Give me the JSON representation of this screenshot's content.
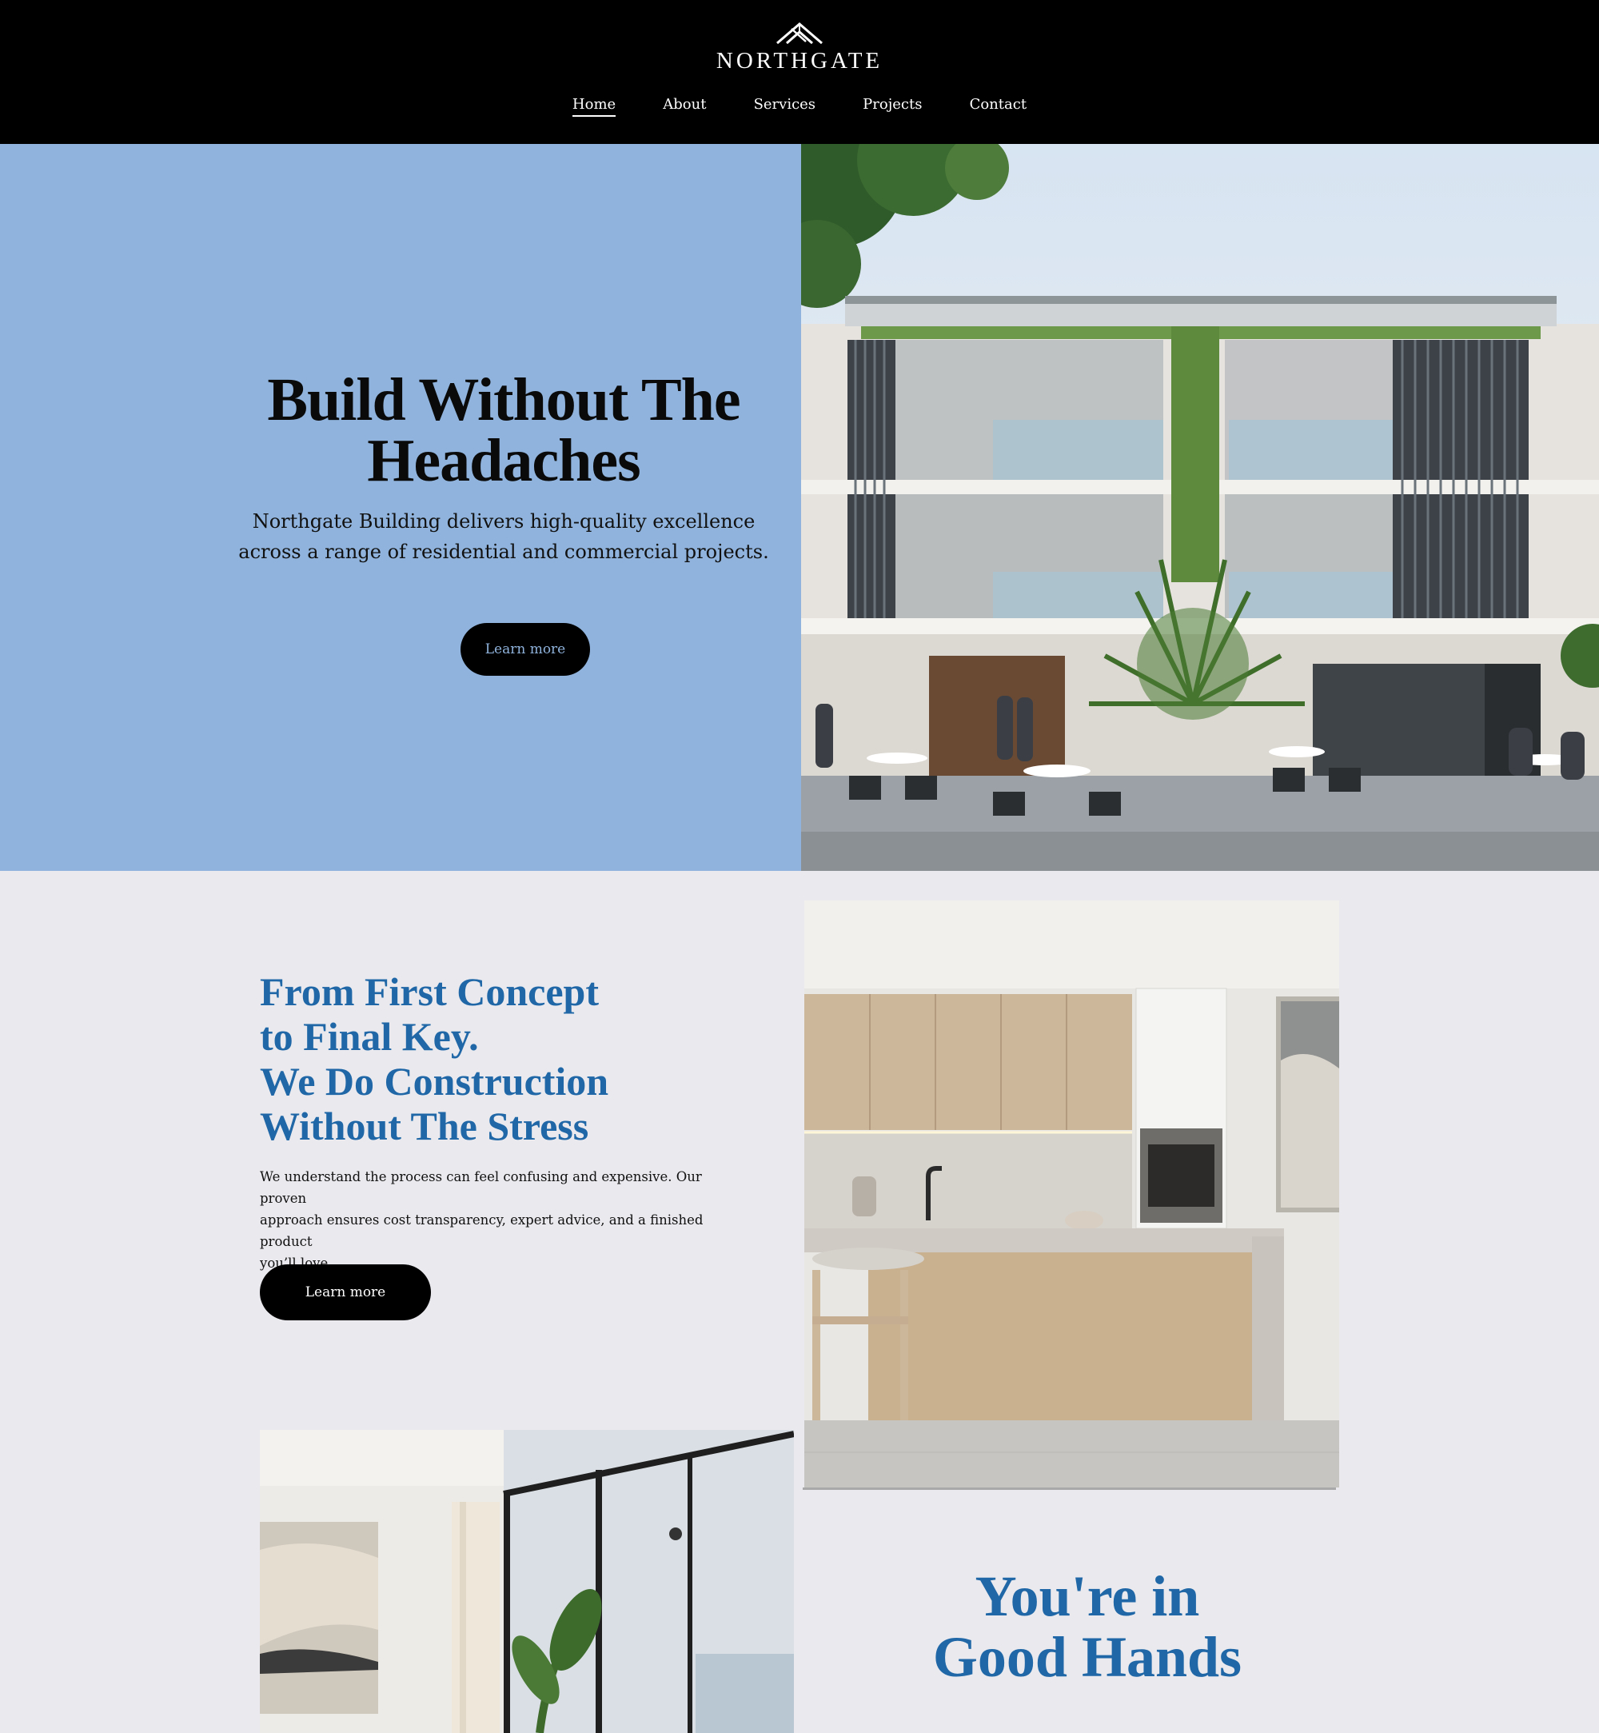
{
  "brand": {
    "name": "NORTHGATE",
    "logo_icon": "roof-chevron-icon"
  },
  "nav": {
    "items": [
      {
        "label": "Home",
        "active": true
      },
      {
        "label": "About",
        "active": false
      },
      {
        "label": "Services",
        "active": false
      },
      {
        "label": "Projects",
        "active": false
      },
      {
        "label": "Contact",
        "active": false
      }
    ]
  },
  "hero": {
    "title_line1": "Build Without The",
    "title_line2": "Headaches",
    "subtitle_line1": "Northgate Building delivers high-quality excellence",
    "subtitle_line2": "across a range of residential and commercial projects.",
    "button_label": "Learn more",
    "background_color": "#8fb3dc"
  },
  "section2": {
    "title_lines": [
      "From First Concept",
      "to Final Key.",
      "We Do Construction",
      "Without The Stress"
    ],
    "body_line1": "We understand the process can feel confusing and expensive. Our proven",
    "body_line2": "approach ensures cost transparency, expert advice, and a finished product",
    "body_line3": "you’ll love.",
    "button_label": "Learn more",
    "accent_color": "#1f67a6"
  },
  "section3": {
    "title_line1": "You're in",
    "title_line2": "Good Hands"
  }
}
